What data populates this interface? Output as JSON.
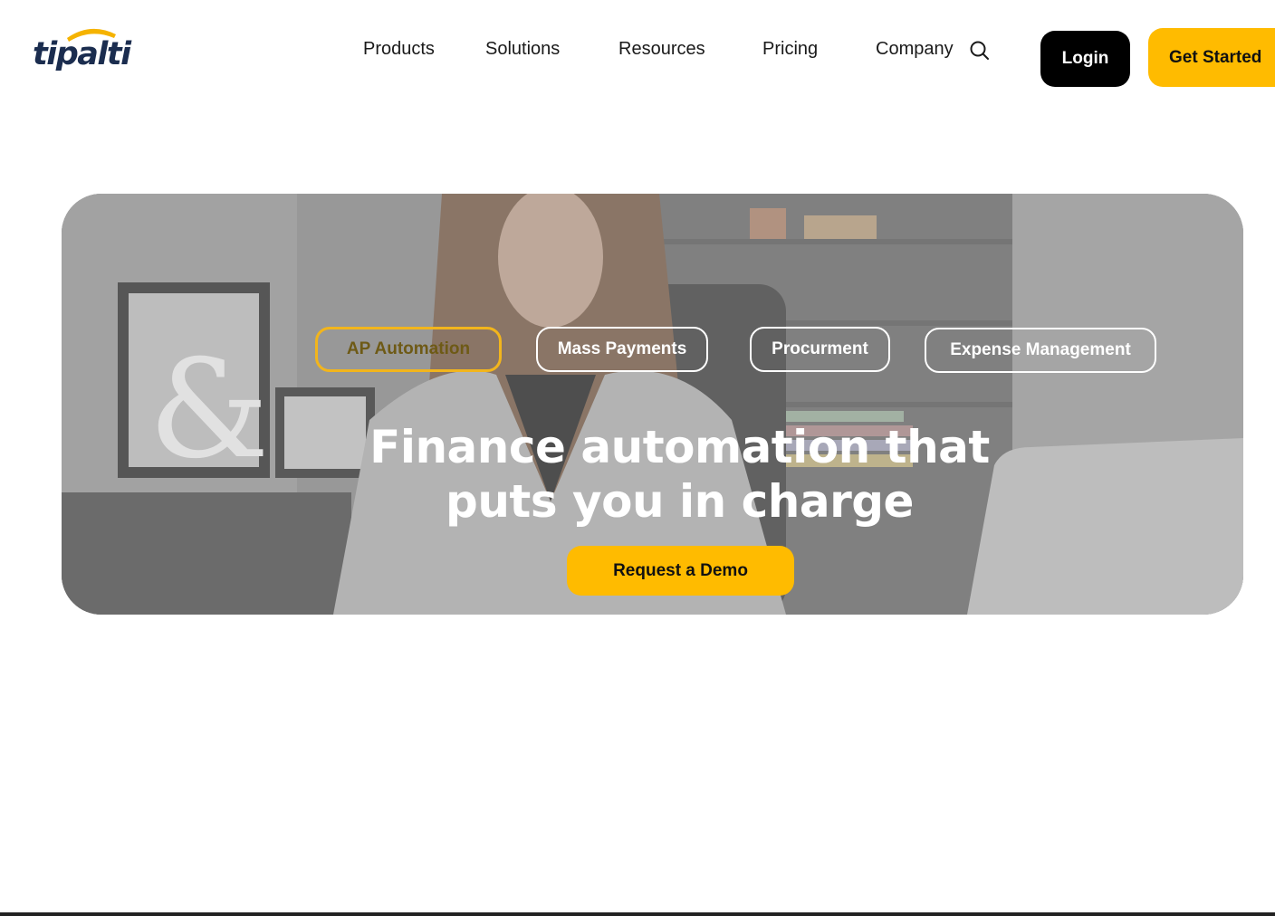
{
  "header": {
    "logo_text": "tipalti",
    "nav": {
      "products": "Products",
      "solutions": "Solutions",
      "resources": "Resources",
      "pricing": "Pricing",
      "company": "Company"
    },
    "login_label": "Login",
    "get_started_label": "Get Started"
  },
  "hero": {
    "tabs": {
      "ap_automation": "AP Automation",
      "mass_payments": "Mass Payments",
      "procurement": "Procurment",
      "expense_management": "Expense Management"
    },
    "active_tab": "AP Automation",
    "title_line1": "Finance automation that",
    "title_line2": "puts you in charge",
    "cta_label": "Request a Demo"
  },
  "colors": {
    "accent": "#ffbb00",
    "logo_navy": "#1b2d4f",
    "active_tab_border": "#f2b51c",
    "login_bg": "#000000"
  },
  "icons": {
    "search": "search-icon"
  }
}
